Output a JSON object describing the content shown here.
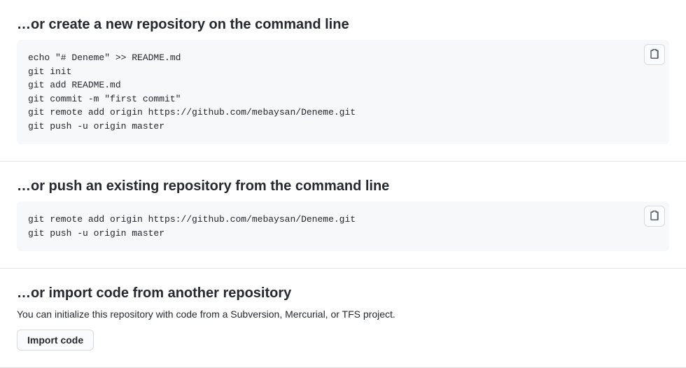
{
  "sections": {
    "create": {
      "heading": "…or create a new repository on the command line",
      "code": "echo \"# Deneme\" >> README.md\ngit init\ngit add README.md\ngit commit -m \"first commit\"\ngit remote add origin https://github.com/mebaysan/Deneme.git\ngit push -u origin master"
    },
    "push": {
      "heading": "…or push an existing repository from the command line",
      "code": "git remote add origin https://github.com/mebaysan/Deneme.git\ngit push -u origin master"
    },
    "import": {
      "heading": "…or import code from another repository",
      "desc": "You can initialize this repository with code from a Subversion, Mercurial, or TFS project.",
      "button": "Import code"
    }
  }
}
